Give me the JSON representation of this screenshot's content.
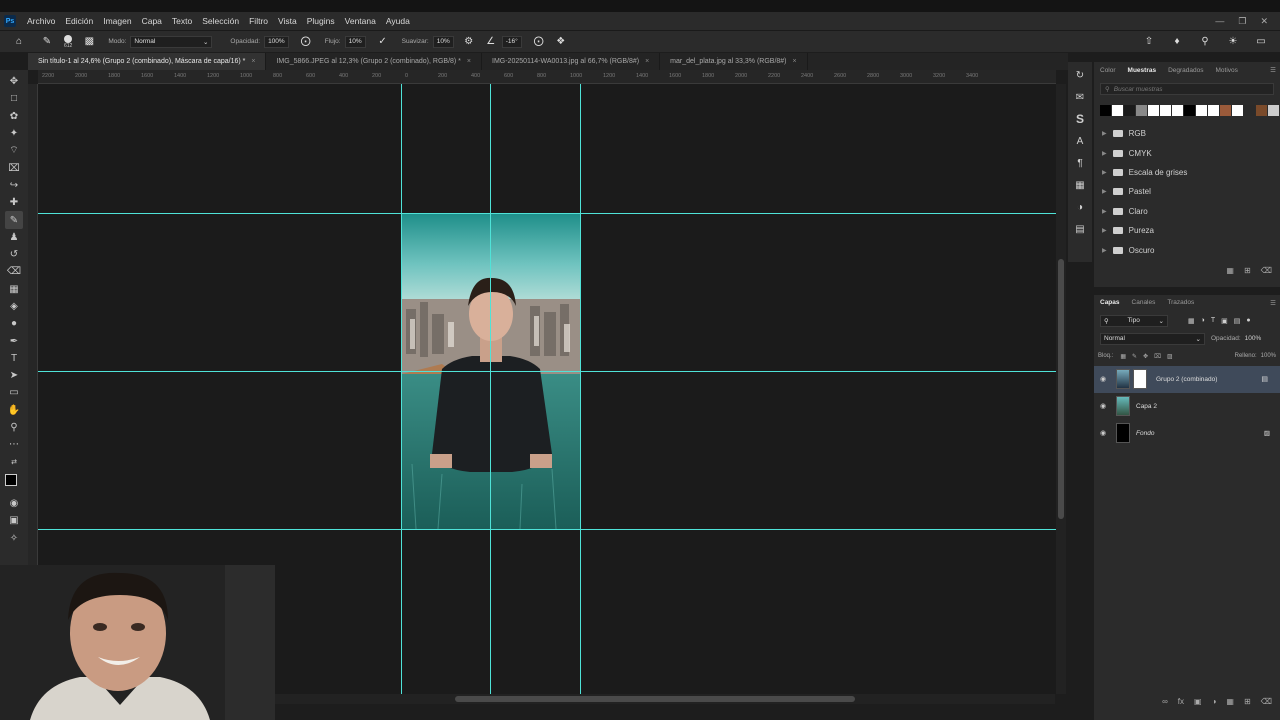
{
  "app": {
    "logo": "Ps"
  },
  "menu": [
    "Archivo",
    "Edición",
    "Imagen",
    "Capa",
    "Texto",
    "Selección",
    "Filtro",
    "Vista",
    "Plugins",
    "Ventana",
    "Ayuda"
  ],
  "options": {
    "mode_label": "Modo:",
    "mode_value": "Normal",
    "opacity_label": "Opacidad:",
    "opacity_value": "100%",
    "flow_label": "Flujo:",
    "flow_value": "10%",
    "smoothing_label": "Suavizar:",
    "smoothing_value": "10%",
    "angle_value": "-16°",
    "brush_size": "612"
  },
  "tabs": [
    {
      "label": "Sin título-1 al 24,6% (Grupo 2 (combinado), Máscara de capa/16) *",
      "active": true
    },
    {
      "label": "IMG_5866.JPEG al 12,3% (Grupo 2 (combinado), RGB/8) *",
      "active": false
    },
    {
      "label": "IMG-20250114-WA0013.jpg al 66,7% (RGB/8#)",
      "active": false
    },
    {
      "label": "mar_del_plata.jpg al 33,3% (RGB/8#)",
      "active": false
    }
  ],
  "ruler_ticks": [
    "2200",
    "2000",
    "1800",
    "1600",
    "1400",
    "1200",
    "1000",
    "800",
    "600",
    "400",
    "200",
    "0",
    "200",
    "400",
    "600",
    "800",
    "1000",
    "1200",
    "1400",
    "1600",
    "1800",
    "2000",
    "2200",
    "2400",
    "2600",
    "2800",
    "3000",
    "3200",
    "3400"
  ],
  "swatches_panel": {
    "tabs": [
      "Color",
      "Muestras",
      "Degradados",
      "Motivos"
    ],
    "active_tab": "Muestras",
    "search_placeholder": "Buscar muestras",
    "colors": [
      "#000000",
      "#ffffff",
      "#1a1a1a",
      "#888888",
      "#ffffff",
      "#ffffff",
      "#ffffff",
      "#000000",
      "#ffffff",
      "#ffffff",
      "#9a5a3a",
      "#ffffff",
      "#2a2a2a",
      "#7a4a2a",
      "#cccccc"
    ],
    "folders": [
      "RGB",
      "CMYK",
      "Escala de grises",
      "Pastel",
      "Claro",
      "Pureza",
      "Oscuro"
    ]
  },
  "layers_panel": {
    "tabs": [
      "Capas",
      "Canales",
      "Trazados"
    ],
    "active_tab": "Capas",
    "filter_label": "Tipo",
    "blend_mode": "Normal",
    "opacity_label": "Opacidad:",
    "opacity_value": "100%",
    "lock_label": "Bloq.:",
    "fill_label": "Relleno:",
    "fill_value": "100%",
    "layers": [
      {
        "name": "Grupo 2 (combinado)",
        "selected": true
      },
      {
        "name": "Capa 2",
        "selected": false
      },
      {
        "name": "Fondo",
        "selected": false
      }
    ]
  },
  "colors": {
    "guide": "#4fe3d8",
    "selection": "#3f4a5a"
  }
}
